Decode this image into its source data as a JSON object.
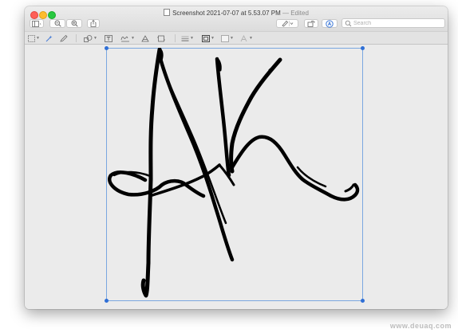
{
  "window": {
    "title": "Screenshot 2021-07-07 at 5.53.07 PM",
    "edited_suffix": "— Edited"
  },
  "toolbar": {
    "search_placeholder": "Search"
  },
  "watermark": "www.deuaq.com",
  "colors": {
    "accent": "#2f6fd6",
    "selection_border": "#7aa7e0",
    "ink": "#000000"
  }
}
